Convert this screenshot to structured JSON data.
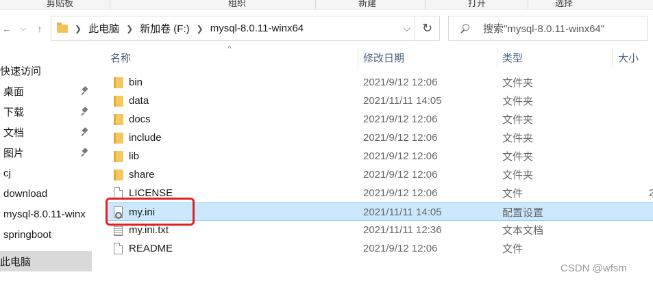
{
  "ribbon": {
    "groups": [
      "剪贴板",
      "组织",
      "新建",
      "打开",
      "选择"
    ]
  },
  "address_bar": {
    "crumbs": [
      "此电脑",
      "新加卷 (F:)",
      "mysql-8.0.11-winx64"
    ],
    "search_placeholder": "搜索\"mysql-8.0.11-winx64\""
  },
  "sidebar": {
    "items": [
      {
        "label": "快速访问",
        "pinned": false
      },
      {
        "label": "桌面",
        "pinned": true
      },
      {
        "label": "下载",
        "pinned": true
      },
      {
        "label": "文档",
        "pinned": true
      },
      {
        "label": "图片",
        "pinned": true
      },
      {
        "label": "cj",
        "pinned": false
      },
      {
        "label": "download",
        "pinned": false
      },
      {
        "label": "mysql-8.0.11-winx",
        "pinned": false
      },
      {
        "label": "springboot",
        "pinned": false
      },
      {
        "label": "此电脑",
        "pinned": false
      }
    ]
  },
  "columns": {
    "name": "名称",
    "date": "修改日期",
    "type": "类型",
    "size": "大小"
  },
  "files": [
    {
      "name": "bin",
      "date": "2021/9/12 12:06",
      "type": "文件夹",
      "size": "",
      "icon": "folder-icon"
    },
    {
      "name": "data",
      "date": "2021/11/11 14:05",
      "type": "文件夹",
      "size": "",
      "icon": "folder-icon"
    },
    {
      "name": "docs",
      "date": "2021/9/12 12:06",
      "type": "文件夹",
      "size": "",
      "icon": "folder-icon"
    },
    {
      "name": "include",
      "date": "2021/9/12 12:06",
      "type": "文件夹",
      "size": "",
      "icon": "folder-icon"
    },
    {
      "name": "lib",
      "date": "2021/9/12 12:06",
      "type": "文件夹",
      "size": "",
      "icon": "folder-icon"
    },
    {
      "name": "share",
      "date": "2021/9/12 12:06",
      "type": "文件夹",
      "size": "",
      "icon": "folder-icon"
    },
    {
      "name": "LICENSE",
      "date": "2021/9/12 12:06",
      "type": "文件",
      "size": "2",
      "icon": "file-icon"
    },
    {
      "name": "my.ini",
      "date": "2021/11/11 14:05",
      "type": "配置设置",
      "size": "",
      "icon": "settings-file-icon",
      "selected": true
    },
    {
      "name": "my.ini.txt",
      "date": "2021/11/11 12:36",
      "type": "文本文档",
      "size": "",
      "icon": "text-file-icon"
    },
    {
      "name": "README",
      "date": "2021/9/12 12:06",
      "type": "文件",
      "size": "",
      "icon": "file-icon"
    }
  ],
  "watermark": "CSDN @wfsm",
  "colors": {
    "selected_row": "#cce8ff",
    "highlight_box": "#e02020",
    "header_text": "#4c607a"
  }
}
